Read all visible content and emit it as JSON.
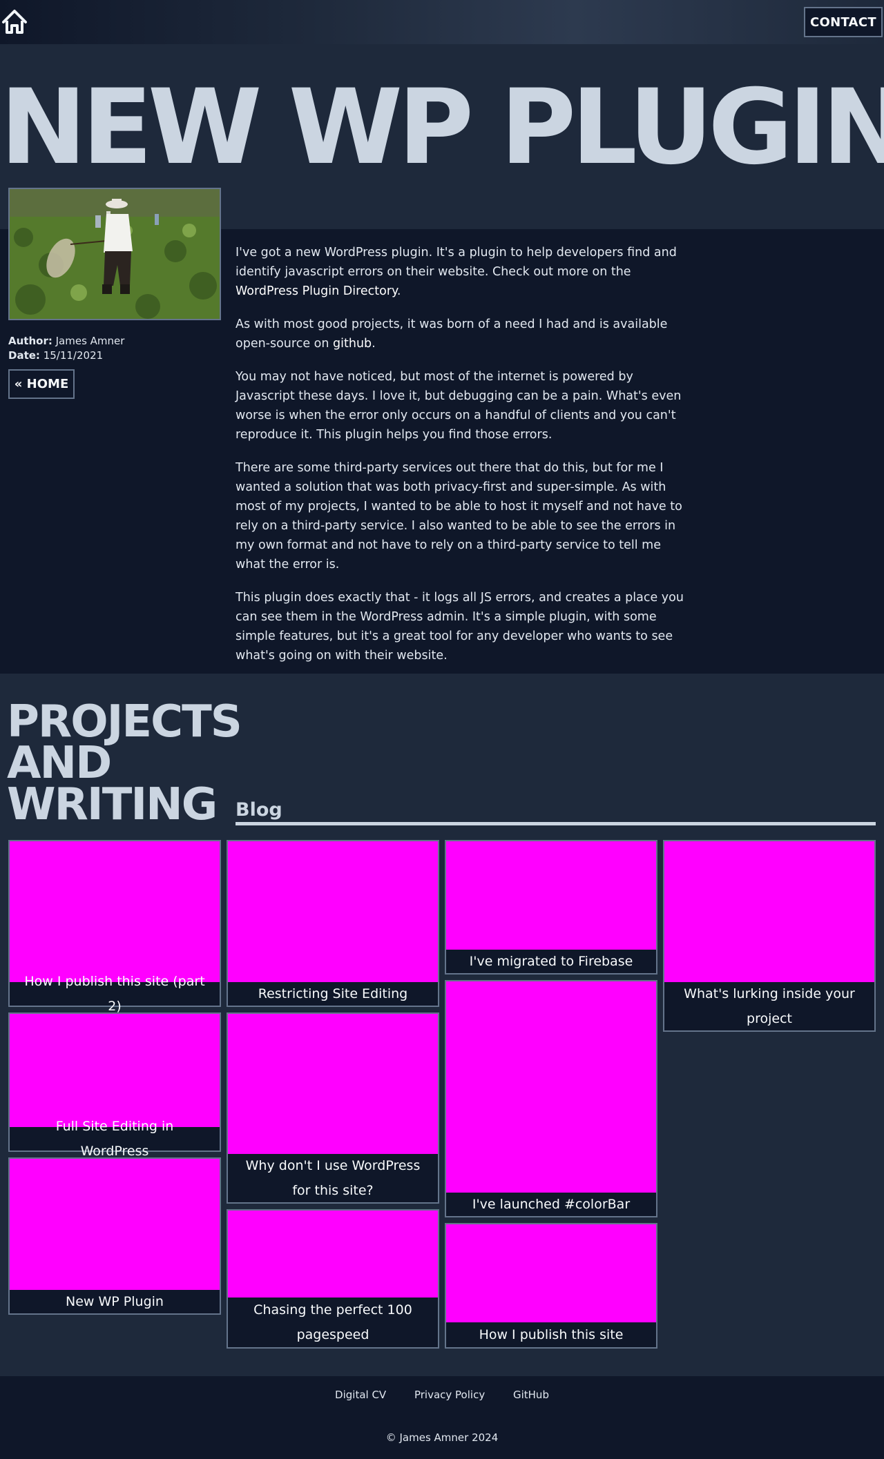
{
  "header": {
    "contact_label": "CONTACT"
  },
  "hero": {
    "title": "NEW WP PLUGIN"
  },
  "post_meta": {
    "author_label": "Author:",
    "author": "James Amner",
    "date_label": "Date:",
    "date": "15/11/2021",
    "home_button": "« HOME"
  },
  "article": {
    "p1_before": "I've got a new WordPress plugin. It's a plugin to help developers find and identify javascript errors on their website. Check out more on the ",
    "p1_link": "WordPress Plugin Directory",
    "p1_after": ".",
    "p2_before": "As with most good projects, it was born of a need I had and is available open-source on ",
    "p2_link": "github",
    "p2_after": ".",
    "p3": "You may not have noticed, but most of the internet is powered by Javascript these days. I love it, but debugging can be a pain. What's even worse is when the error only occurs on a handful of clients and you can't reproduce it. This plugin helps you find those errors.",
    "p4": "There are some third-party services out there that do this, but for me I wanted a solution that was both privacy-first and super-simple. As with most of my projects, I wanted to be able to host it myself and not have to rely on a third-party service. I also wanted to be able to see the errors in my own format and not have to rely on a third-party service to tell me what the error is.",
    "p5": "This plugin does exactly that - it logs all JS errors, and creates a place you can see them in the WordPress admin. It's a simple plugin, with some simple features, but it's a great tool for any developer who wants to see what's going on with their website."
  },
  "projects": {
    "title": "PROJECTS AND WRITING",
    "blog_label": "Blog",
    "cards": [
      "How I publish this site (part 2)",
      "Restricting Site Editing",
      "I've migrated to Firebase",
      "What's lurking inside your project",
      "Full Site Editing in WordPress",
      "Why don't I use WordPress for this site?",
      "I've launched #colorBar",
      "New WP Plugin",
      "Chasing the perfect 100 pagespeed",
      "How I publish this site"
    ],
    "thumb_color": "#ff00ff"
  },
  "footer": {
    "links": [
      "Digital CV",
      "Privacy Policy",
      "GitHub"
    ],
    "copyright": "© James Amner 2024"
  },
  "colors": {
    "background": "#0f1729",
    "surface": "#1e293b",
    "title": "#cbd5e1",
    "border": "#64748b"
  }
}
